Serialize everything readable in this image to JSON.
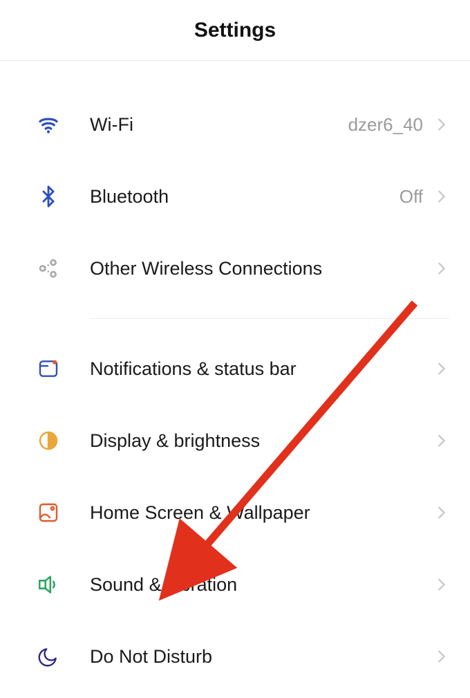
{
  "header": {
    "title": "Settings"
  },
  "groups": [
    {
      "items": [
        {
          "id": "wifi",
          "label": "Wi-Fi",
          "value": "dzer6_40",
          "icon": "wifi-icon"
        },
        {
          "id": "bluetooth",
          "label": "Bluetooth",
          "value": "Off",
          "icon": "bluetooth-icon"
        },
        {
          "id": "other-wireless",
          "label": "Other Wireless Connections",
          "value": "",
          "icon": "wireless-share-icon"
        }
      ]
    },
    {
      "items": [
        {
          "id": "notifications",
          "label": "Notifications & status bar",
          "value": "",
          "icon": "notification-icon"
        },
        {
          "id": "display",
          "label": "Display & brightness",
          "value": "",
          "icon": "brightness-icon"
        },
        {
          "id": "home-wallpaper",
          "label": "Home Screen & Wallpaper",
          "value": "",
          "icon": "wallpaper-icon"
        },
        {
          "id": "sound",
          "label": "Sound & vibration",
          "value": "",
          "icon": "sound-icon"
        },
        {
          "id": "dnd",
          "label": "Do Not Disturb",
          "value": "",
          "icon": "moon-icon"
        }
      ]
    }
  ]
}
